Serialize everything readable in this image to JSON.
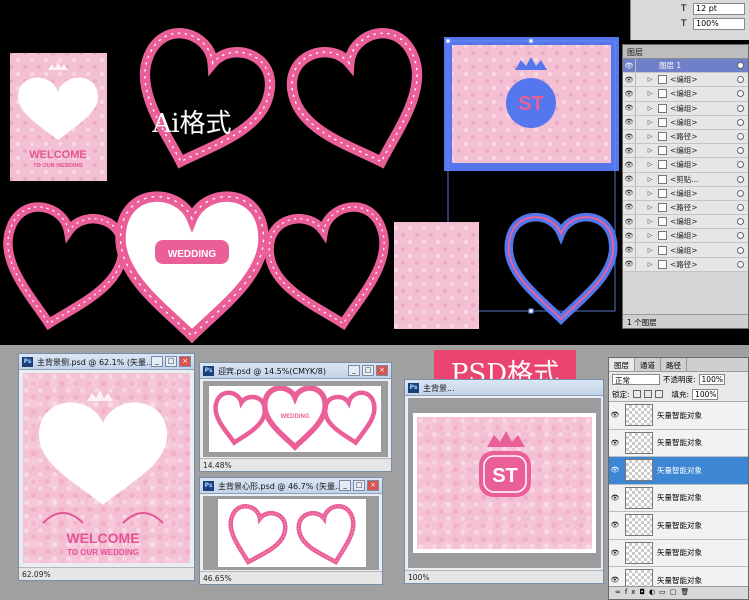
{
  "labels": {
    "ai_format": "Ai格式",
    "psd_format": "PSD格式",
    "welcome": "WELCOME",
    "to_our_wedding": "TO OUR WEDDING",
    "wedding": "WEDDING",
    "st": "ST"
  },
  "colors": {
    "pink": "#ea5f98",
    "light_pink": "#f4c0d4",
    "blue_selection": "#5577ee",
    "psd_banner": "#e9456f"
  },
  "ai_toolbar": {
    "font_size": "12 pt",
    "scale": "100%"
  },
  "ai_layers_panel": {
    "tab": "图层",
    "top_layer": "图层 1",
    "rows": [
      "<编组>",
      "<编组>",
      "<编组>",
      "<编组>",
      "<路径>",
      "<编组>",
      "<编组>",
      "<剪贴...",
      "<编组>",
      "<路径>",
      "<编组>",
      "<编组>",
      "<编组>",
      "<路径>"
    ],
    "footer": "1 个图层"
  },
  "psd_windows": {
    "main": {
      "title": "主背景侧.psd @ 62.1% (矢量...",
      "zoom": "62.09%"
    },
    "welcome": {
      "title": "迎宾.psd @ 14.5%(CMYK/8)",
      "zoom": "14.48%"
    },
    "heart": {
      "title": "主背景心形.psd @ 46.7% (矢量...",
      "zoom": "46.65%"
    },
    "bg": {
      "title": "主背景...",
      "zoom": "100%"
    }
  },
  "ps_layers_panel": {
    "tabs": [
      "图层",
      "通道",
      "路径"
    ],
    "blend_mode": "正常",
    "opacity_label": "不透明度:",
    "opacity_value": "100%",
    "lock_label": "锁定:",
    "fill_label": "填充:",
    "fill_value": "100%",
    "layers": [
      "矢量智能对象",
      "矢量智能对象",
      "矢量智能对象",
      "矢量智能对象",
      "矢量智能对象",
      "矢量智能对象",
      "矢量智能对象"
    ]
  }
}
